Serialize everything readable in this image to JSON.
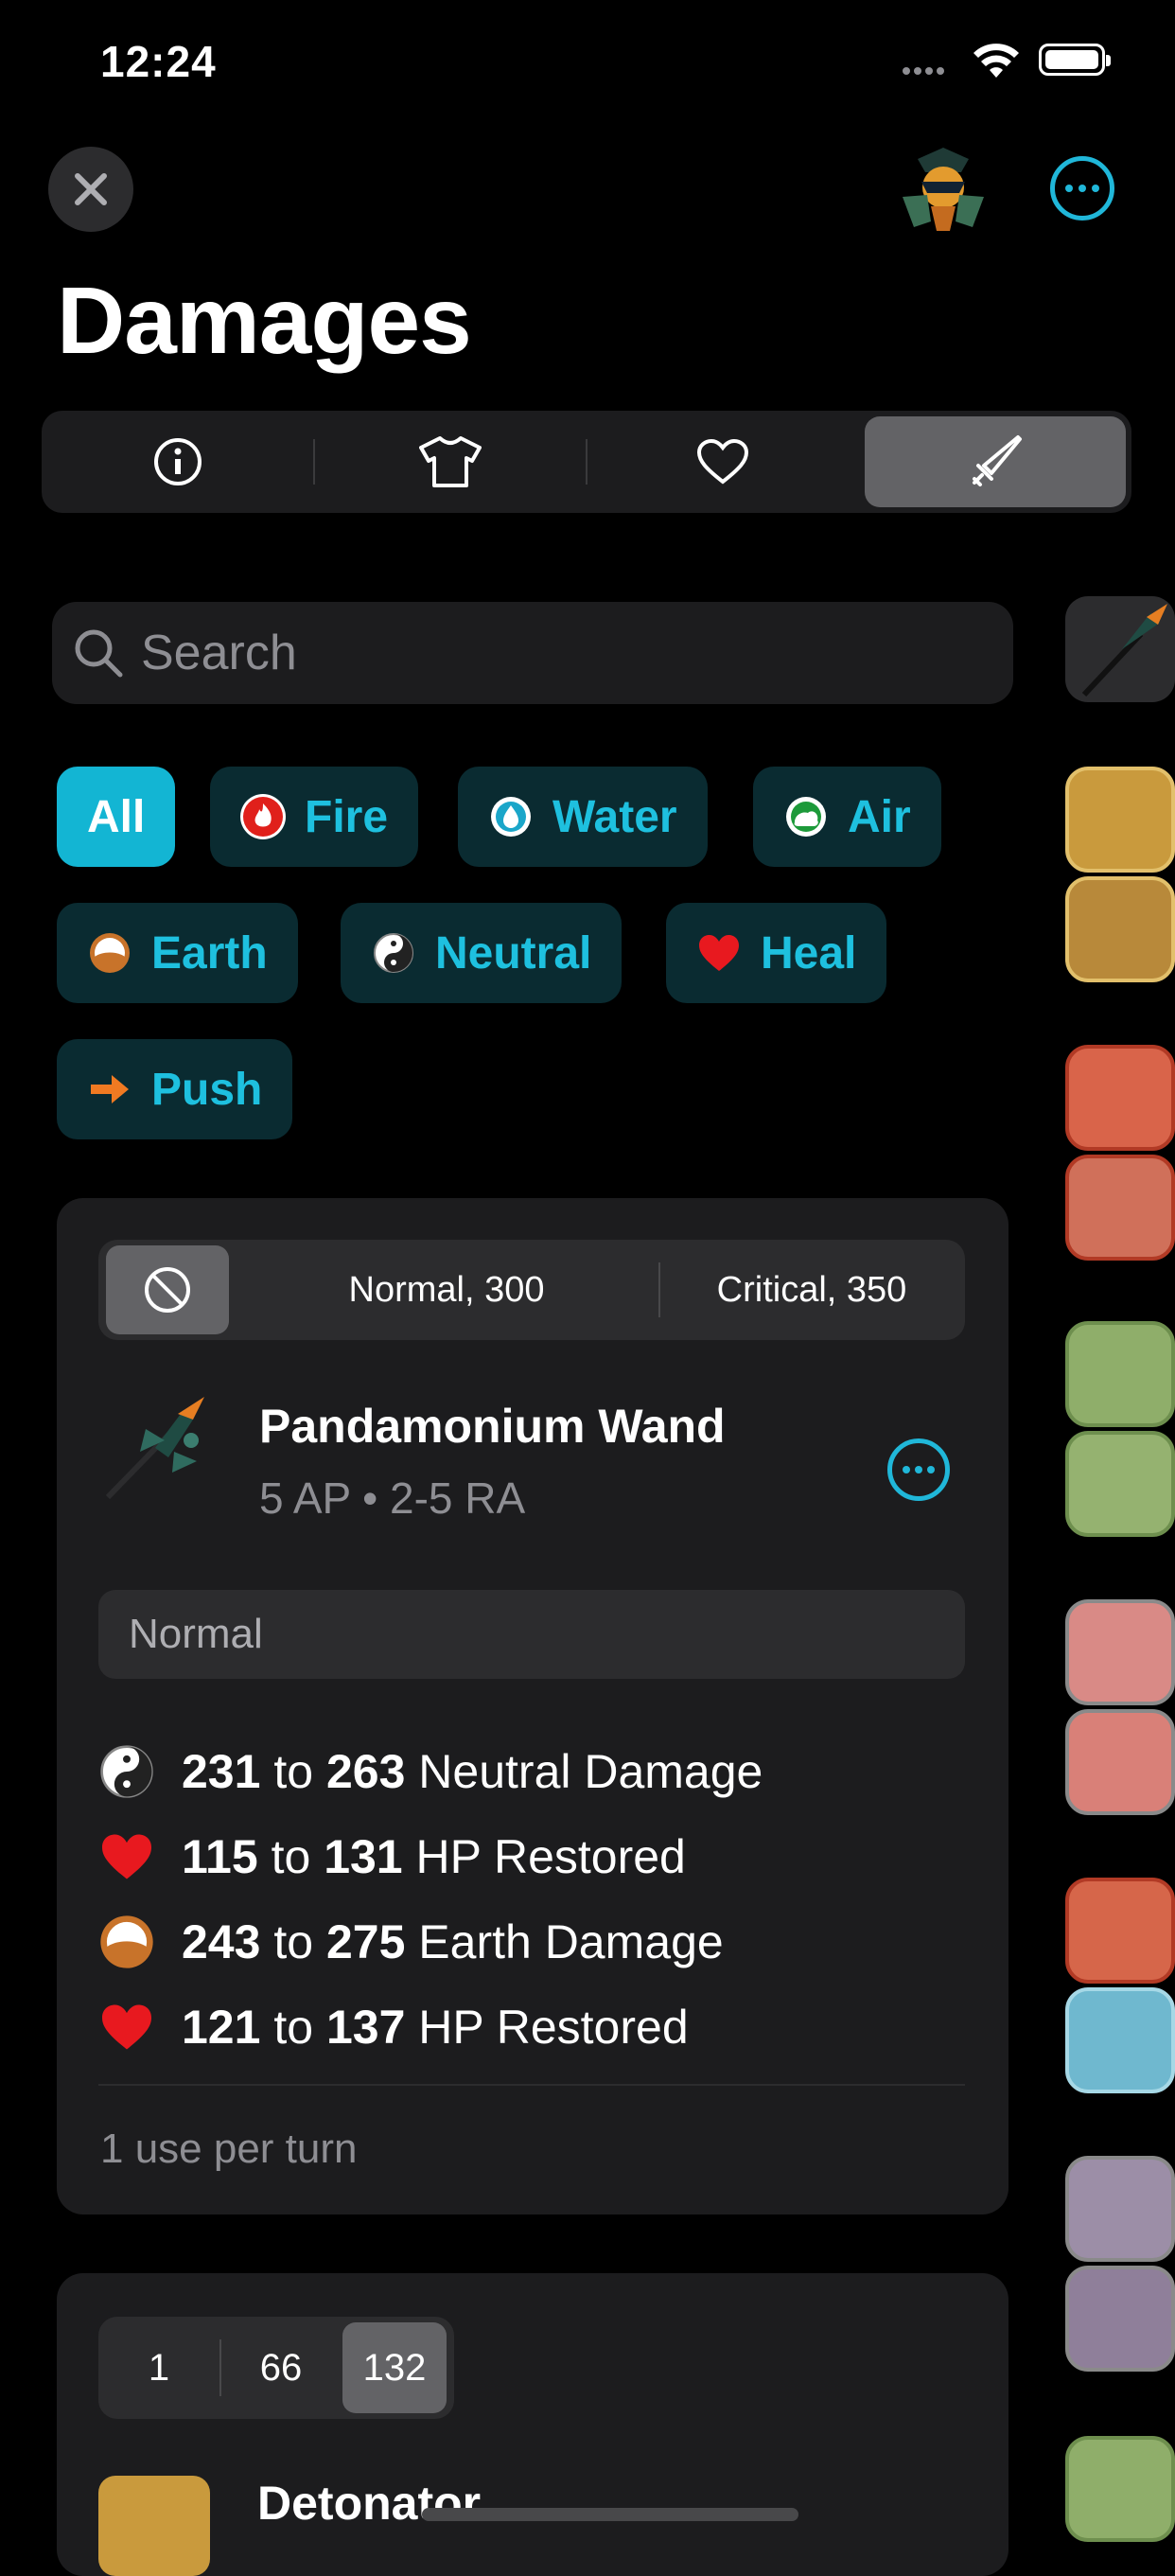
{
  "status": {
    "time": "12:24"
  },
  "header": {
    "title": "Damages"
  },
  "tabs": [
    {
      "name": "info"
    },
    {
      "name": "equipment"
    },
    {
      "name": "favorites"
    },
    {
      "name": "damages",
      "selected": true
    }
  ],
  "search": {
    "placeholder": "Search"
  },
  "filters": [
    {
      "label": "All",
      "active": true
    },
    {
      "label": "Fire",
      "icon": "fire-icon",
      "color": "#e0201b"
    },
    {
      "label": "Water",
      "icon": "water-icon",
      "color": "#1aa6c9"
    },
    {
      "label": "Air",
      "icon": "air-icon",
      "color": "#1d9a3a"
    },
    {
      "label": "Earth",
      "icon": "earth-icon",
      "color": "#c8732a"
    },
    {
      "label": "Neutral",
      "icon": "neutral-icon",
      "color": "#555555"
    },
    {
      "label": "Heal",
      "icon": "heart-icon",
      "color": "#e8191f"
    },
    {
      "label": "Push",
      "icon": "arrow-icon",
      "color": "#f07a22"
    }
  ],
  "weapon_card": {
    "damage_modes": [
      "Normal, 300",
      "Critical, 350"
    ],
    "name": "Pandamonium Wand",
    "meta": "5 AP • 2-5 RA",
    "section": "Normal",
    "effects": [
      {
        "icon": "neutral-icon",
        "min": "231",
        "to": "to",
        "max": "263",
        "label": "Neutral Damage"
      },
      {
        "icon": "heart-icon",
        "min": "115",
        "to": "to",
        "max": "131",
        "label": "HP Restored"
      },
      {
        "icon": "earth-icon",
        "min": "243",
        "to": "to",
        "max": "275",
        "label": "Earth Damage"
      },
      {
        "icon": "heart-icon",
        "min": "121",
        "to": "to",
        "max": "137",
        "label": "HP Restored"
      }
    ],
    "uses": "1 use per turn"
  },
  "spell_card": {
    "levels": [
      "1",
      "66",
      "132"
    ],
    "selected_level": "132",
    "name": "Detonator"
  },
  "colors": {
    "accent": "#20b7d9",
    "card": "#1c1c1e",
    "chip_bg": "#0a2b31"
  }
}
